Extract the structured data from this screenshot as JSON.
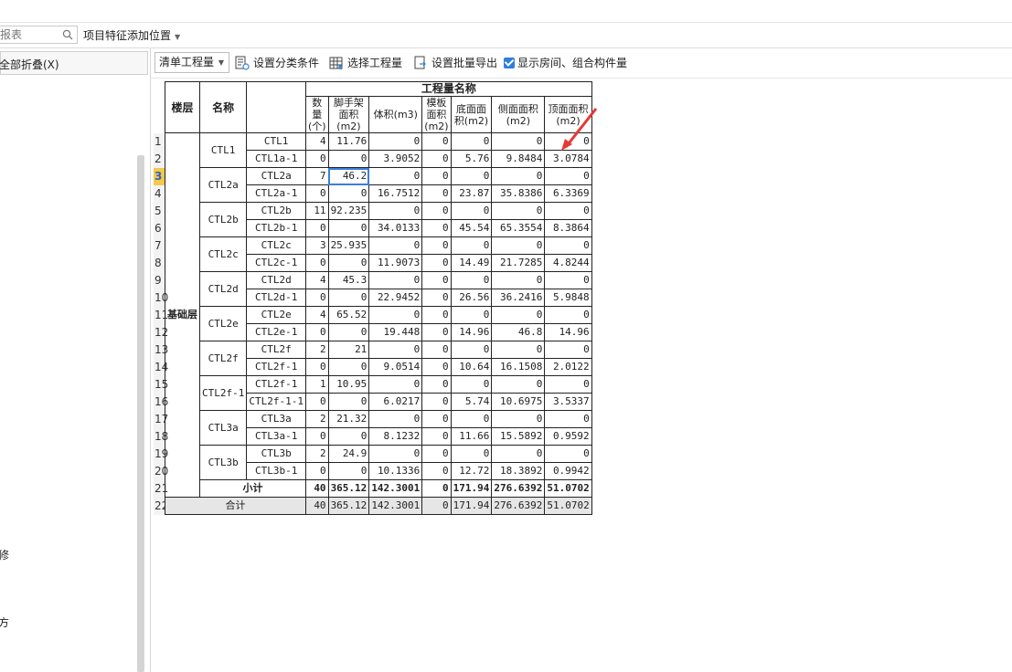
{
  "toolbar": {
    "search_placeholder": "报表",
    "feature_position": "项目特征添加位置",
    "quantity_type": "清单工程量",
    "set_category": "设置分类条件",
    "select_quantity": "选择工程量",
    "batch_export": "设置批量导出",
    "show_rooms_label": "显示房间、组合构件量",
    "show_rooms_checked": true
  },
  "left_panel": {
    "collapse_all": "全部折叠(X)",
    "items": [
      "修",
      "方"
    ]
  },
  "table": {
    "floor_header": "楼层",
    "name_header": "名称",
    "group_header": "工程量名称",
    "columns": [
      "数量(个)",
      "脚手架面积(m2)",
      "体积(m3)",
      "模板面积(m2)",
      "底面面积(m2)",
      "侧面面积(m2)",
      "顶面面积(m2)"
    ],
    "floor": "基础层",
    "groups": [
      {
        "name": "CTL1",
        "rows": [
          {
            "sub": "CTL1",
            "values": [
              "4",
              "11.76",
              "0",
              "0",
              "0",
              "0",
              "0"
            ]
          },
          {
            "sub": "CTL1a-1",
            "values": [
              "0",
              "0",
              "3.9052",
              "0",
              "5.76",
              "9.8484",
              "3.0784"
            ]
          }
        ]
      },
      {
        "name": "CTL2a",
        "rows": [
          {
            "sub": "CTL2a",
            "values": [
              "7",
              "46.2",
              "0",
              "0",
              "0",
              "0",
              "0"
            ]
          },
          {
            "sub": "CTL2a-1",
            "values": [
              "0",
              "0",
              "16.7512",
              "0",
              "23.87",
              "35.8386",
              "6.3369"
            ]
          }
        ]
      },
      {
        "name": "CTL2b",
        "rows": [
          {
            "sub": "CTL2b",
            "values": [
              "11",
              "92.235",
              "0",
              "0",
              "0",
              "0",
              "0"
            ]
          },
          {
            "sub": "CTL2b-1",
            "values": [
              "0",
              "0",
              "34.0133",
              "0",
              "45.54",
              "65.3554",
              "8.3864"
            ]
          }
        ]
      },
      {
        "name": "CTL2c",
        "rows": [
          {
            "sub": "CTL2c",
            "values": [
              "3",
              "25.935",
              "0",
              "0",
              "0",
              "0",
              "0"
            ]
          },
          {
            "sub": "CTL2c-1",
            "values": [
              "0",
              "0",
              "11.9073",
              "0",
              "14.49",
              "21.7285",
              "4.8244"
            ]
          }
        ]
      },
      {
        "name": "CTL2d",
        "rows": [
          {
            "sub": "CTL2d",
            "values": [
              "4",
              "45.3",
              "0",
              "0",
              "0",
              "0",
              "0"
            ]
          },
          {
            "sub": "CTL2d-1",
            "values": [
              "0",
              "0",
              "22.9452",
              "0",
              "26.56",
              "36.2416",
              "5.9848"
            ]
          }
        ]
      },
      {
        "name": "CTL2e",
        "rows": [
          {
            "sub": "CTL2e",
            "values": [
              "4",
              "65.52",
              "0",
              "0",
              "0",
              "0",
              "0"
            ]
          },
          {
            "sub": "CTL2e-1",
            "values": [
              "0",
              "0",
              "19.448",
              "0",
              "14.96",
              "46.8",
              "14.96"
            ]
          }
        ]
      },
      {
        "name": "CTL2f",
        "rows": [
          {
            "sub": "CTL2f",
            "values": [
              "2",
              "21",
              "0",
              "0",
              "0",
              "0",
              "0"
            ]
          },
          {
            "sub": "CTL2f-1",
            "values": [
              "0",
              "0",
              "9.0514",
              "0",
              "10.64",
              "16.1508",
              "2.0122"
            ]
          }
        ]
      },
      {
        "name": "CTL2f-1",
        "rows": [
          {
            "sub": "CTL2f-1",
            "values": [
              "1",
              "10.95",
              "0",
              "0",
              "0",
              "0",
              "0"
            ]
          },
          {
            "sub": "CTL2f-1-1",
            "values": [
              "0",
              "0",
              "6.0217",
              "0",
              "5.74",
              "10.6975",
              "3.5337"
            ]
          }
        ]
      },
      {
        "name": "CTL3a",
        "rows": [
          {
            "sub": "CTL3a",
            "values": [
              "2",
              "21.32",
              "0",
              "0",
              "0",
              "0",
              "0"
            ]
          },
          {
            "sub": "CTL3a-1",
            "values": [
              "0",
              "0",
              "8.1232",
              "0",
              "11.66",
              "15.5892",
              "0.9592"
            ]
          }
        ]
      },
      {
        "name": "CTL3b",
        "rows": [
          {
            "sub": "CTL3b",
            "values": [
              "2",
              "24.9",
              "0",
              "0",
              "0",
              "0",
              "0"
            ]
          },
          {
            "sub": "CTL3b-1",
            "values": [
              "0",
              "0",
              "10.1336",
              "0",
              "12.72",
              "18.3892",
              "0.9942"
            ]
          }
        ]
      }
    ],
    "subtotal_label": "小计",
    "subtotal_values": [
      "40",
      "365.12",
      "142.3001",
      "0",
      "171.94",
      "276.6392",
      "51.0702"
    ],
    "total_label": "合计",
    "total_values": [
      "40",
      "365.12",
      "142.3001",
      "0",
      "171.94",
      "276.6392",
      "51.0702"
    ],
    "row_numbers": [
      "1",
      "2",
      "3",
      "4",
      "5",
      "6",
      "7",
      "8",
      "9",
      "10",
      "11",
      "12",
      "13",
      "14",
      "15",
      "16",
      "17",
      "18",
      "19",
      "20",
      "21",
      "22"
    ],
    "active_row": "3"
  },
  "colors": {
    "accent": "#3a7fd8",
    "annotation_arrow": "#e53935",
    "active_row_bg": "#f4c84a",
    "total_row_bg": "#e6e6e6"
  }
}
